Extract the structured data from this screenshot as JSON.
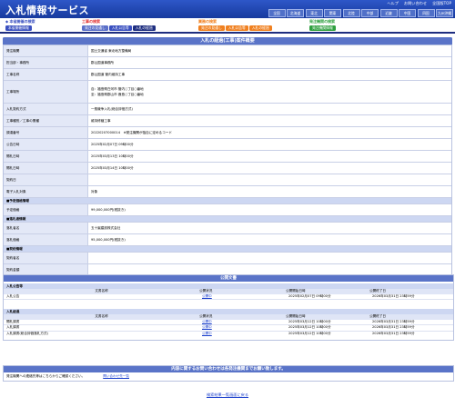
{
  "header": {
    "title": "入札情報サービス",
    "links": [
      "ヘルプ",
      "お問い合わせ",
      "全国版TOP"
    ],
    "regions": [
      "全国",
      "北海道",
      "東北",
      "関東",
      "北陸",
      "中部",
      "近畿",
      "中国",
      "四国",
      "九州沖縄"
    ]
  },
  "nav": {
    "groups": [
      {
        "caption": "◆ 本省開催の検索",
        "color": "#3a50c0",
        "tabs": [
          {
            "label": "本省開催情報",
            "color": "#3a50c0"
          }
        ]
      },
      {
        "caption": "工事の検索",
        "color": "#e03030",
        "tabs": [
          {
            "label": "発注の見通し",
            "color": "#5a6fc8"
          },
          {
            "label": "入札公告等",
            "color": "#3a50c0"
          },
          {
            "label": "入札の経過",
            "color": "#1e2e80"
          }
        ]
      },
      {
        "caption": "業務の検索",
        "color": "#f08020",
        "tabs": [
          {
            "label": "発注の見通し",
            "color": "#f08020"
          },
          {
            "label": "入札公告等",
            "color": "#f08020"
          },
          {
            "label": "入札の経過",
            "color": "#f08020"
          }
        ]
      },
      {
        "caption": "発注機関の検索",
        "color": "#2fa040",
        "tabs": [
          {
            "label": "発注機関情報",
            "color": "#2fa040"
          }
        ]
      }
    ]
  },
  "detail": {
    "title": "入札の経過(工事)案件概要",
    "rows": [
      {
        "label": "発注機関",
        "value": "国土交通省 東北地方整備局"
      },
      {
        "label": "担当部・事務所",
        "value": "郡山国道事務所"
      },
      {
        "label": "工事名称",
        "value": "郡山国道 管内維持工事"
      },
      {
        "label": "工事場所",
        "value": "自：福島県白河市 管内○丁目○番地\n至：福島県郡山市 鹿島○丁目○番地"
      },
      {
        "label": "入札契約方式",
        "value": "一般競争入札(総合評価方式)"
      },
      {
        "label": "工事種別／工事の業種",
        "value": "維持修繕工事"
      },
      {
        "label": "調達番号",
        "value": "20220207000014　※発注機関が独自に定めるコード"
      },
      {
        "label": "公告日時",
        "value": "2025年02月07日 09時00分"
      },
      {
        "label": "開札日時",
        "value": "2025年03月13日 10時00分"
      },
      {
        "label": "開札日時",
        "value": "2025年03月14日 10時00分"
      },
      {
        "label": "契約日",
        "value": ""
      },
      {
        "label": "電子入札対象",
        "value": "対象"
      }
    ],
    "sections": [
      {
        "title": "■予定価格情報",
        "rows": [
          {
            "label": "予定価格",
            "value": "99,000,000円(税抜き)"
          }
        ]
      },
      {
        "title": "■落札者情報",
        "rows": [
          {
            "label": "落札者名",
            "value": "五十嵐建設株式会社"
          },
          {
            "label": "落札価格",
            "value": "95,000,000円(税抜き)"
          }
        ]
      },
      {
        "title": "■契約情報",
        "rows": [
          {
            "label": "契約者名",
            "value": ""
          },
          {
            "label": "契約金額",
            "value": ""
          }
        ]
      }
    ]
  },
  "documents": {
    "title": "公開文書",
    "columns": [
      "文書名称",
      "公開状況",
      "公開開始日時",
      "公開終了日"
    ],
    "sections": [
      {
        "title": "入札公告等",
        "rows": [
          {
            "name": "入札公告",
            "status": "公開中",
            "start": "2025年02月07日 09時00分",
            "end": "2026年03月31日 23時59分"
          }
        ]
      },
      {
        "title": "入札経過",
        "rows": [
          {
            "name": "開札調書",
            "status": "公開中",
            "start": "2025年03月12日 10時00分",
            "end": "2026年03月31日 23時59分"
          },
          {
            "name": "入札調書",
            "status": "公開中",
            "start": "2025年03月12日 10時00分",
            "end": "2026年03月31日 23時59分"
          },
          {
            "name": "入札調書(総合評価落札方式)",
            "status": "公開中",
            "start": "2025年03月12日 10時00分",
            "end": "2026年03月31日 23時59分"
          }
        ]
      }
    ]
  },
  "contact": {
    "title": "内容に関するお問い合わせは各発注機関までお願い致します。",
    "text": "発注機関への連絡先等はこちらからご確認ください。",
    "link": "問い合わせ先一覧"
  },
  "back_link": "検索結果一覧画面に戻る"
}
